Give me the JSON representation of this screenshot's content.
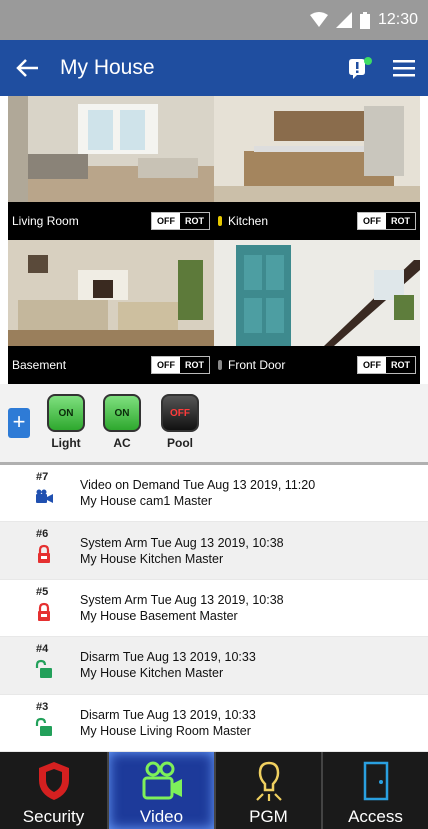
{
  "status": {
    "time": "12:30"
  },
  "header": {
    "title": "My House"
  },
  "cameras": [
    {
      "name": "Living Room",
      "off": "OFF",
      "rot": "ROT"
    },
    {
      "name": "Kitchen",
      "off": "OFF",
      "rot": "ROT"
    },
    {
      "name": "Basement",
      "off": "OFF",
      "rot": "ROT"
    },
    {
      "name": "Front Door",
      "off": "OFF",
      "rot": "ROT"
    }
  ],
  "add_label": "+",
  "pgms": [
    {
      "state": "ON",
      "label": "Light"
    },
    {
      "state": "ON",
      "label": "AC"
    },
    {
      "state": "OFF",
      "label": "Pool"
    }
  ],
  "events": [
    {
      "num": "#7",
      "icon": "video-camera-icon",
      "line1": "Video on Demand Tue Aug 13 2019, 11:20",
      "line2": "My House cam1 Master"
    },
    {
      "num": "#6",
      "icon": "lock-closed-icon",
      "line1": "System Arm Tue Aug 13 2019, 10:38",
      "line2": "My House Kitchen Master"
    },
    {
      "num": "#5",
      "icon": "lock-closed-icon",
      "line1": "System Arm Tue Aug 13 2019, 10:38",
      "line2": "My House Basement Master"
    },
    {
      "num": "#4",
      "icon": "lock-open-icon",
      "line1": "Disarm Tue Aug 13 2019, 10:33",
      "line2": "My House Kitchen Master"
    },
    {
      "num": "#3",
      "icon": "lock-open-icon",
      "line1": "Disarm Tue Aug 13 2019, 10:33",
      "line2": "My House Living Room Master"
    }
  ],
  "nav": [
    {
      "label": "Security",
      "icon": "shield-icon"
    },
    {
      "label": "Video",
      "icon": "camcorder-icon"
    },
    {
      "label": "PGM",
      "icon": "lightbulb-icon"
    },
    {
      "label": "Access",
      "icon": "door-icon"
    }
  ],
  "colors": {
    "app_bar": "#1f4ea0",
    "active_tab": "#1d3a9a",
    "arm_red": "#e53030",
    "disarm_green": "#22a05a",
    "video_blue": "#2050b0"
  }
}
